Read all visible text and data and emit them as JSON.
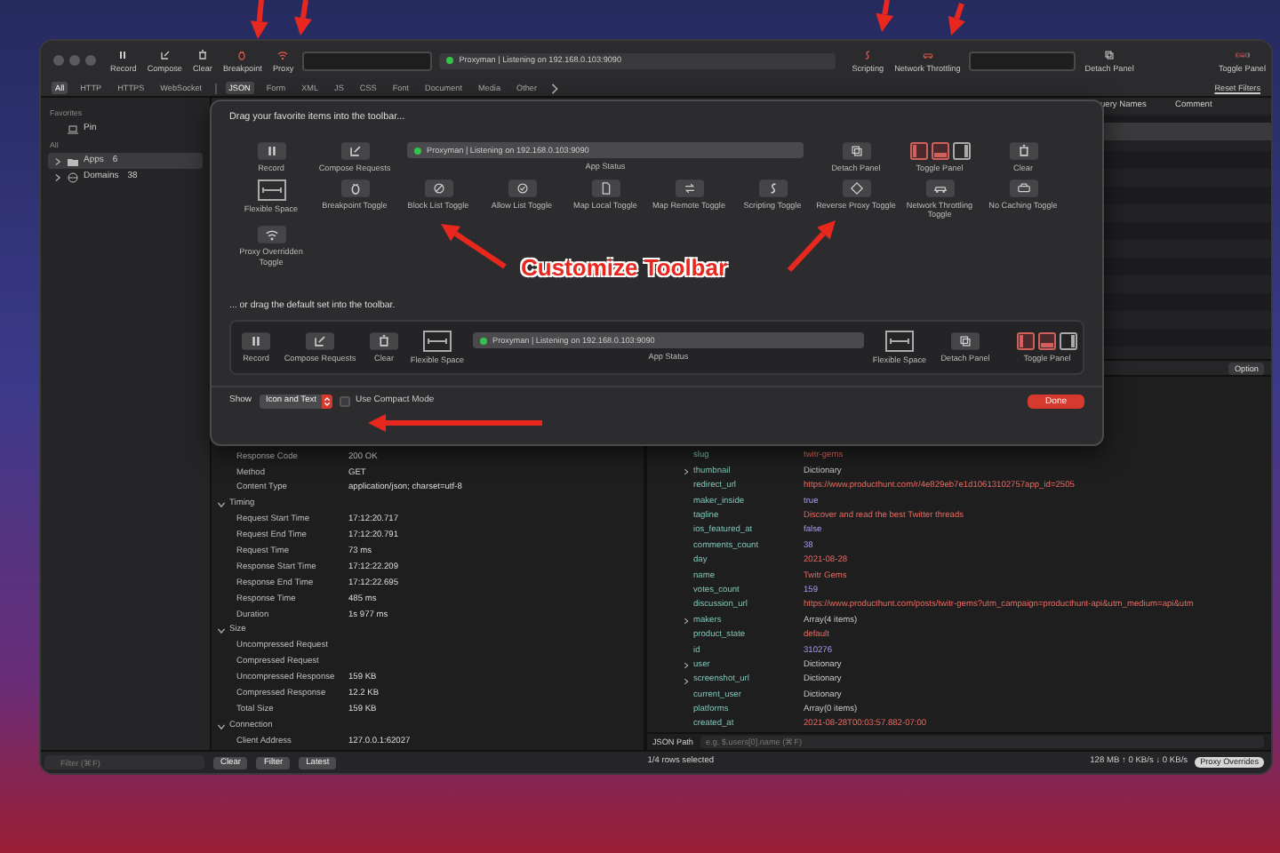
{
  "toolbar": {
    "items": [
      {
        "kind": "pause",
        "label": "Record",
        "on": false
      },
      {
        "kind": "compose",
        "label": "Compose",
        "on": false
      },
      {
        "kind": "trash",
        "label": "Clear",
        "on": false
      },
      {
        "kind": "bug",
        "label": "Breakpoint",
        "on": true
      },
      {
        "kind": "wifi",
        "label": "Proxy",
        "on": true
      },
      {
        "kind": "blank"
      },
      {
        "kind": "status",
        "text": "Proxyman | Listening on 192.168.0.103:9090"
      },
      {
        "kind": "script",
        "label": "Scripting",
        "on": true
      },
      {
        "kind": "car",
        "label": "Network Throttling",
        "on": true
      },
      {
        "kind": "blank"
      },
      {
        "kind": "detach",
        "label": "Detach Panel",
        "on": false
      },
      {
        "kind": "panels",
        "label": "Toggle Panel",
        "on": false
      }
    ]
  },
  "filter_tabs": [
    {
      "label": "All",
      "selected": true
    },
    {
      "label": "HTTP",
      "selected": false
    },
    {
      "label": "HTTPS",
      "selected": false
    },
    {
      "label": "WebSocket",
      "selected": false
    },
    {
      "label": "JSON",
      "selected": true
    },
    {
      "label": "Form",
      "selected": false
    },
    {
      "label": "XML",
      "selected": false
    },
    {
      "label": "JS",
      "selected": false
    },
    {
      "label": "CSS",
      "selected": false
    },
    {
      "label": "Font",
      "selected": false
    },
    {
      "label": "Document",
      "selected": false
    },
    {
      "label": "Media",
      "selected": false
    },
    {
      "label": "Other",
      "selected": false
    }
  ],
  "reset_filters": "Reset Filters",
  "sidebar": {
    "sections": [
      {
        "title": "Favorites",
        "items": [
          {
            "kind": "laptop",
            "label": "Pin",
            "selected": false
          }
        ]
      },
      {
        "title": "All",
        "items": [
          {
            "kind": "folder",
            "label": "Apps",
            "count": "6",
            "expanded": false,
            "selected": true
          },
          {
            "kind": "globe",
            "label": "Domains",
            "count": "38",
            "expanded": false,
            "selected": false
          }
        ]
      }
    ]
  },
  "table": {
    "columns": [
      "uery Names",
      "Comment"
    ]
  },
  "detail": {
    "option_button": "Option",
    "rows": [
      {
        "key": "Response Code",
        "value": "200 OK"
      },
      {
        "key": "Method",
        "value": "GET"
      },
      {
        "key": "Content Type",
        "value": "application/json; charset=utf-8"
      }
    ],
    "sections": [
      {
        "title": "Timing",
        "expanded": true,
        "rows": [
          {
            "key": "Request Start Time",
            "value": "17:12:20.717"
          },
          {
            "key": "Request End Time",
            "value": "17:12:20.791"
          },
          {
            "key": "Request Time",
            "value": "73 ms"
          },
          {
            "key": "Response Start Time",
            "value": "17:12:22.209"
          },
          {
            "key": "Response End Time",
            "value": "17:12:22.695"
          },
          {
            "key": "Response Time",
            "value": "485 ms"
          },
          {
            "key": "Duration",
            "value": "1s 977 ms"
          }
        ]
      },
      {
        "title": "Size",
        "expanded": true,
        "rows": [
          {
            "key": "Uncompressed Request"
          },
          {
            "key": "Compressed Request"
          },
          {
            "key": "Uncompressed Response",
            "value": "159 KB"
          },
          {
            "key": "Compressed Response",
            "value": "12.2 KB"
          },
          {
            "key": "Total Size",
            "value": "159 KB"
          }
        ]
      },
      {
        "title": "Connection",
        "expanded": true,
        "rows": [
          {
            "key": "Client Address",
            "value": "127.0.0.1:62027"
          }
        ]
      }
    ]
  },
  "json_view": {
    "rows": [
      {
        "key": "slug",
        "value": "twitr-gems",
        "kind": "string"
      },
      {
        "key": "thumbnail",
        "value": "Dictionary",
        "kind": "object",
        "expanded": false
      },
      {
        "key": "redirect_url",
        "value": "https://www.producthunt.com/r/4e829eb7e1d10613102757app_id=2505",
        "kind": "string"
      },
      {
        "key": "maker_inside",
        "value": "true",
        "kind": "number"
      },
      {
        "key": "tagline",
        "value": "Discover and read the best Twitter threads",
        "kind": "string"
      },
      {
        "key": "ios_featured_at",
        "value": "false",
        "kind": "number"
      },
      {
        "key": "comments_count",
        "value": "38",
        "kind": "number"
      },
      {
        "key": "day",
        "value": "2021-08-28",
        "kind": "string"
      },
      {
        "key": "name",
        "value": "Twitr Gems",
        "kind": "string"
      },
      {
        "key": "votes_count",
        "value": "159",
        "kind": "number"
      },
      {
        "key": "discussion_url",
        "value": "https://www.producthunt.com/posts/twitr-gems?utm_campaign=producthunt-api&utm_medium=api&utm",
        "kind": "string"
      },
      {
        "key": "makers",
        "value": "Array(4 items)",
        "kind": "object",
        "expanded": false
      },
      {
        "key": "product_state",
        "value": "default",
        "kind": "string"
      },
      {
        "key": "id",
        "value": "310276",
        "kind": "number"
      },
      {
        "key": "user",
        "value": "Dictionary",
        "kind": "object",
        "expanded": false
      },
      {
        "key": "screenshot_url",
        "value": "Dictionary",
        "kind": "object",
        "expanded": false
      },
      {
        "key": "current_user",
        "value": "Dictionary",
        "kind": "object"
      },
      {
        "key": "platforms",
        "value": "Array(0 items)",
        "kind": "object"
      },
      {
        "key": "created_at",
        "value": "2021-08-28T00:03:57.882-07:00",
        "kind": "string"
      }
    ],
    "path_label": "JSON Path",
    "path_placeholder": "e.g. $.users[0].name (⌘F)"
  },
  "status_bar": {
    "filter_placeholder": "Filter (⌘F)",
    "buttons": [
      "Clear",
      "Filter",
      "Latest"
    ],
    "selection": "1/4 rows selected",
    "traffic": "128 MB ↑ 0 KB/s ↓ 0 KB/s",
    "proxy_overrides": "Proxy Overrides"
  },
  "sheet": {
    "title": "Drag your favorite items into the toolbar...",
    "items": [
      {
        "kind": "pause",
        "label": "Record"
      },
      {
        "kind": "compose",
        "label": "Compose Requests"
      },
      {
        "kind": "status",
        "text": "Proxyman | Listening on 192.168.0.103:9090",
        "label": "App Status"
      },
      {
        "kind": "detach",
        "label": "Detach Panel"
      },
      {
        "kind": "panels",
        "label": "Toggle Panel"
      },
      {
        "kind": "trash",
        "label": "Clear"
      },
      {
        "kind": "flex",
        "label": "Flexible Space"
      },
      {
        "kind": "bug",
        "label": "Breakpoint Toggle"
      },
      {
        "kind": "block",
        "label": "Block List Toggle"
      },
      {
        "kind": "allow",
        "label": "Allow List Toggle"
      },
      {
        "kind": "doc",
        "label": "Map Local Toggle"
      },
      {
        "kind": "repeat",
        "label": "Map Remote Toggle"
      },
      {
        "kind": "script",
        "label": "Scripting Toggle"
      },
      {
        "kind": "diamond",
        "label": "Reverse Proxy Toggle"
      },
      {
        "kind": "car",
        "label": "Network Throttling Toggle"
      },
      {
        "kind": "drive",
        "label": "No Caching Toggle"
      },
      {
        "kind": "wifi",
        "label": "Proxy Overridden Toggle"
      }
    ],
    "default_title": "... or drag the default set into the toolbar.",
    "default_set": [
      {
        "kind": "pause",
        "label": "Record"
      },
      {
        "kind": "compose",
        "label": "Compose Requests"
      },
      {
        "kind": "trash",
        "label": "Clear"
      },
      {
        "kind": "flex",
        "label": "Flexible Space"
      },
      {
        "kind": "status",
        "text": "Proxyman | Listening on 192.168.0.103:9090",
        "label": "App Status"
      },
      {
        "kind": "flex",
        "label": "Flexible Space"
      },
      {
        "kind": "detach",
        "label": "Detach Panel"
      },
      {
        "kind": "panels",
        "label": "Toggle Panel"
      }
    ],
    "show_label": "Show",
    "show_value": "Icon and Text",
    "compact": {
      "label": "Use Compact Mode",
      "checked": false
    },
    "done": "Done"
  },
  "annotation": "Customize Toolbar"
}
